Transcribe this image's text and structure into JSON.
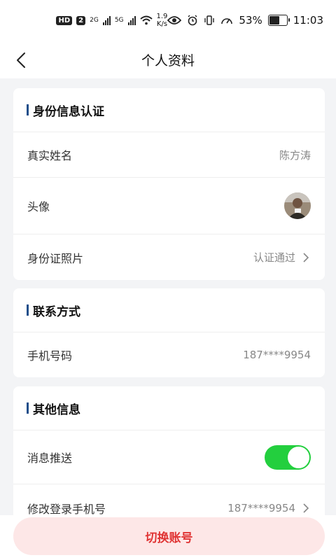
{
  "status_bar": {
    "hd_badge": "HD",
    "sim_badge": "2",
    "net1": "2G",
    "net2": "5G",
    "speed_value": "1.9",
    "speed_unit": "K/s",
    "battery_percent": "53%",
    "time": "11:03",
    "battery_level": 0.53
  },
  "header": {
    "title": "个人资料"
  },
  "identity": {
    "title": "身份信息认证",
    "real_name_label": "真实姓名",
    "real_name_value": "陈方涛",
    "avatar_label": "头像",
    "id_photo_label": "身份证照片",
    "id_photo_value": "认证通过"
  },
  "contact": {
    "title": "联系方式",
    "phone_label": "手机号码",
    "phone_value": "187****9954"
  },
  "other": {
    "title": "其他信息",
    "push_label": "消息推送",
    "push_enabled": true,
    "change_phone_label": "修改登录手机号",
    "change_phone_value": "187****9954"
  },
  "footer": {
    "switch_account_label": "切换账号"
  },
  "colors": {
    "accent_bar": "#1f4e8a",
    "toggle_on": "#23cf3e",
    "danger_text": "#e03434",
    "danger_bg": "#fde7e7"
  }
}
